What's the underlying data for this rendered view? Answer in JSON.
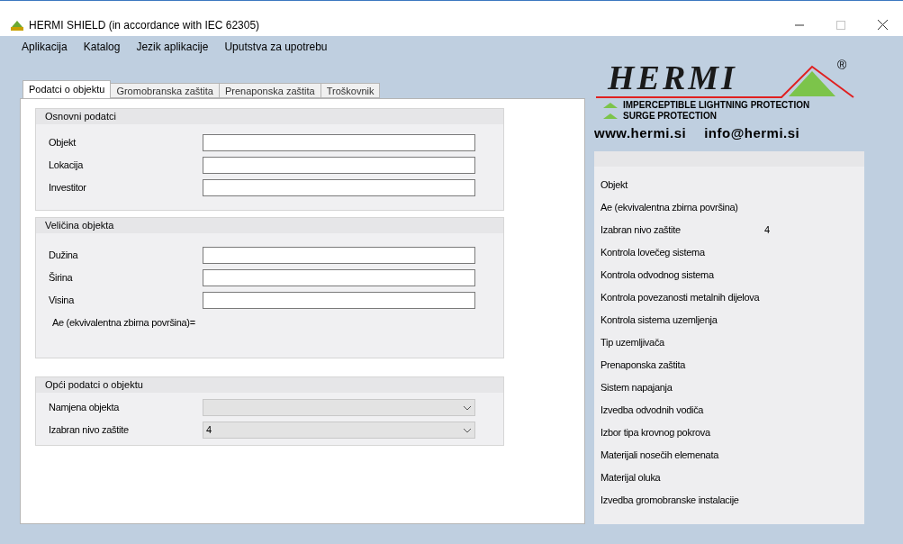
{
  "window": {
    "title": "HERMI SHIELD (in accordance with IEC 62305)",
    "maximize_disabled": true
  },
  "menu": [
    "Aplikacija",
    "Katalog",
    "Jezik aplikacije",
    "Uputstva za upotrebu"
  ],
  "tabs": [
    {
      "label": "Podatci o objektu",
      "selected": true
    },
    {
      "label": "Gromobranska zaštita",
      "selected": false
    },
    {
      "label": "Prenaponska zaštita",
      "selected": false
    },
    {
      "label": "Troškovnik",
      "selected": false
    }
  ],
  "groups": [
    {
      "title": "Osnovni podatci",
      "fields": [
        {
          "kind": "text",
          "label": "Objekt"
        },
        {
          "kind": "text",
          "label": "Lokacija"
        },
        {
          "kind": "text",
          "label": "Investitor"
        }
      ]
    },
    {
      "title": "Veličina objekta",
      "fields": [
        {
          "kind": "text",
          "label": "Dužina"
        },
        {
          "kind": "text",
          "label": "Širina"
        },
        {
          "kind": "text",
          "label": "Visina"
        },
        {
          "kind": "note",
          "label": "Ae (ekvivalentna zbirna površina)="
        }
      ]
    },
    {
      "title": "Opći podatci o objektu",
      "fields": [
        {
          "kind": "select",
          "label": "Namjena objekta",
          "disabled": true
        },
        {
          "kind": "select",
          "label": "Izabran nivo zaštite",
          "value": "4",
          "disabled": true
        }
      ]
    }
  ],
  "logo": {
    "wordmark": "HERMI",
    "registered": "®",
    "lines": [
      "IMPERCEPTIBLE LIGHTNING PROTECTION",
      "SURGE PROTECTION"
    ],
    "website": "www.hermi.si",
    "email": "info@hermi.si"
  },
  "summary": [
    {
      "label": "Objekt"
    },
    {
      "label": "Ae (ekvivalentna zbirna površina)"
    },
    {
      "label": "Izabran nivo zaštite",
      "value": "4"
    },
    {
      "label": "Kontrola lovečeg sistema"
    },
    {
      "label": "Kontrola odvodnog sistema"
    },
    {
      "label": "Kontrola povezanosti metalnih dijelova"
    },
    {
      "label": "Kontrola sistema uzemljenja"
    },
    {
      "label": "Tip uzemljivača"
    },
    {
      "label": "Prenaponska zaštita"
    },
    {
      "label": "Sistem napajanja"
    },
    {
      "label": "Izvedba odvodnih vodiča"
    },
    {
      "label": "Izbor tipa krovnog pokrova"
    },
    {
      "label": "Materijali nosečih elemenata"
    },
    {
      "label": "Materijal oluka"
    },
    {
      "label": "Izvedba gromobranske instalacije"
    }
  ]
}
